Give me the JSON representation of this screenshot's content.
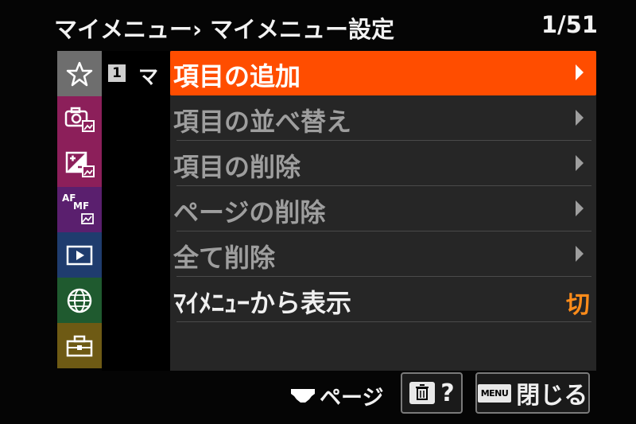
{
  "header": {
    "title": "マイメニュー› マイメニュー設定",
    "page_counter": "1/51"
  },
  "sidebar": {
    "tabs": [
      {
        "id": "my-menu",
        "icon": "star-icon",
        "color": "#6e6e6e"
      },
      {
        "id": "shooting",
        "icon": "camera-photo-icon",
        "color": "#8c1f5a"
      },
      {
        "id": "exposure-color",
        "icon": "exposure-photo-icon",
        "color": "#8c1f5a"
      },
      {
        "id": "focus",
        "icon": "af-mf-icon",
        "color": "#5a1f6e",
        "text_af": "AF",
        "text_mf": "MF"
      },
      {
        "id": "playback",
        "icon": "playback-icon",
        "color": "#1f3c6e"
      },
      {
        "id": "network",
        "icon": "globe-icon",
        "color": "#1f5a2f"
      },
      {
        "id": "setup",
        "icon": "toolbox-icon",
        "color": "#6e5a14"
      }
    ]
  },
  "subtab": {
    "number": "1",
    "label": "マ"
  },
  "menu": {
    "items": [
      {
        "label": "項目の追加",
        "selected": true
      },
      {
        "label": "項目の並べ替え"
      },
      {
        "label": "項目の削除"
      },
      {
        "label": "ページの削除"
      },
      {
        "label": "全て削除"
      },
      {
        "label": "ﾏｲﾒﾆｭｰから表示",
        "value": "切"
      }
    ]
  },
  "footer": {
    "page_label": "ページ",
    "trash_label": "?",
    "menu_chip": "MENU",
    "close_label": "閉じる"
  },
  "colors": {
    "accent": "#ff4d00",
    "value_orange": "#ff8c1a"
  }
}
